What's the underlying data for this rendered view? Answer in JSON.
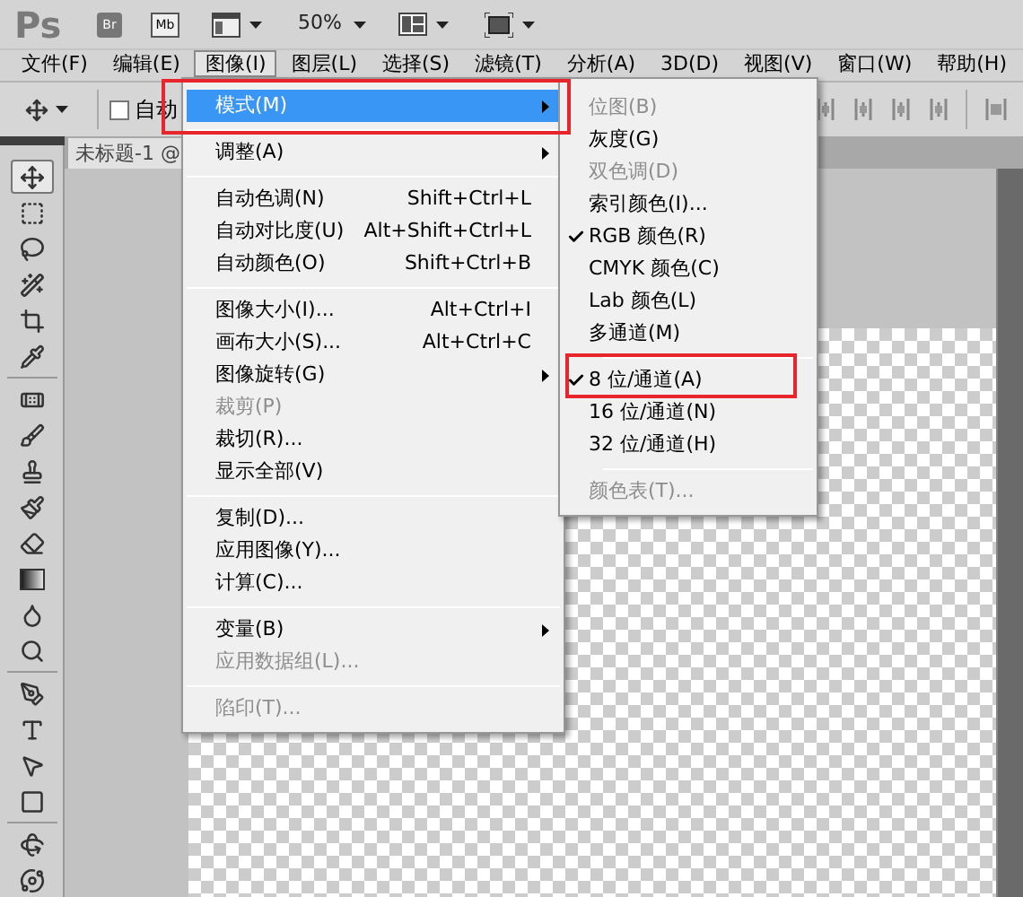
{
  "app_bar": {
    "logo": "Ps",
    "bridge": "Br",
    "mini_bridge": "Mb",
    "zoom": "50%"
  },
  "menu_bar": [
    {
      "label": "文件(F)",
      "selected": false
    },
    {
      "label": "编辑(E)",
      "selected": false
    },
    {
      "label": "图像(I)",
      "selected": true
    },
    {
      "label": "图层(L)",
      "selected": false
    },
    {
      "label": "选择(S)",
      "selected": false
    },
    {
      "label": "滤镜(T)",
      "selected": false
    },
    {
      "label": "分析(A)",
      "selected": false
    },
    {
      "label": "3D(D)",
      "selected": false
    },
    {
      "label": "视图(V)",
      "selected": false
    },
    {
      "label": "窗口(W)",
      "selected": false
    },
    {
      "label": "帮助(H)",
      "selected": false
    }
  ],
  "options_bar": {
    "auto_select": {
      "label": "自动",
      "checked": false
    }
  },
  "tools": [
    {
      "kind": "move",
      "selected": true
    },
    {
      "kind": "marquee",
      "selected": false
    },
    {
      "kind": "lasso",
      "selected": false
    },
    {
      "kind": "wand",
      "selected": false
    },
    {
      "kind": "crop",
      "selected": false
    },
    {
      "kind": "eyedropper",
      "selected": false
    },
    {
      "kind": "separator"
    },
    {
      "kind": "healing",
      "selected": false
    },
    {
      "kind": "brush",
      "selected": false
    },
    {
      "kind": "stamp",
      "selected": false
    },
    {
      "kind": "history",
      "selected": false
    },
    {
      "kind": "eraser",
      "selected": false
    },
    {
      "kind": "gradient",
      "selected": false
    },
    {
      "kind": "blur",
      "selected": false
    },
    {
      "kind": "dodge",
      "selected": false
    },
    {
      "kind": "separator"
    },
    {
      "kind": "pen",
      "selected": false
    },
    {
      "kind": "type",
      "selected": false
    },
    {
      "kind": "select",
      "selected": false
    },
    {
      "kind": "shape",
      "selected": false
    },
    {
      "kind": "separator"
    },
    {
      "kind": "rotate3d",
      "selected": false
    },
    {
      "kind": "orbit",
      "selected": false
    }
  ],
  "document_tab": {
    "title": "未标题-1 @"
  },
  "image_menu": {
    "items": [
      {
        "kind": "item",
        "label": "模式(M)",
        "submenu": true,
        "selected": true,
        "disabled": false
      },
      {
        "kind": "separator"
      },
      {
        "kind": "item",
        "label": "调整(A)",
        "submenu": true,
        "selected": false,
        "disabled": false
      },
      {
        "kind": "separator"
      },
      {
        "kind": "item",
        "label": "自动色调(N)",
        "shortcut": "Shift+Ctrl+L",
        "submenu": false,
        "selected": false,
        "disabled": false
      },
      {
        "kind": "item",
        "label": "自动对比度(U)",
        "shortcut": "Alt+Shift+Ctrl+L",
        "submenu": false,
        "selected": false,
        "disabled": false
      },
      {
        "kind": "item",
        "label": "自动颜色(O)",
        "shortcut": "Shift+Ctrl+B",
        "submenu": false,
        "selected": false,
        "disabled": false
      },
      {
        "kind": "separator"
      },
      {
        "kind": "item",
        "label": "图像大小(I)...",
        "shortcut": "Alt+Ctrl+I",
        "submenu": false,
        "selected": false,
        "disabled": false
      },
      {
        "kind": "item",
        "label": "画布大小(S)...",
        "shortcut": "Alt+Ctrl+C",
        "submenu": false,
        "selected": false,
        "disabled": false
      },
      {
        "kind": "item",
        "label": "图像旋转(G)",
        "submenu": true,
        "selected": false,
        "disabled": false
      },
      {
        "kind": "item",
        "label": "裁剪(P)",
        "submenu": false,
        "selected": false,
        "disabled": true
      },
      {
        "kind": "item",
        "label": "裁切(R)...",
        "submenu": false,
        "selected": false,
        "disabled": false
      },
      {
        "kind": "item",
        "label": "显示全部(V)",
        "submenu": false,
        "selected": false,
        "disabled": false
      },
      {
        "kind": "separator"
      },
      {
        "kind": "item",
        "label": "复制(D)...",
        "submenu": false,
        "selected": false,
        "disabled": false
      },
      {
        "kind": "item",
        "label": "应用图像(Y)...",
        "submenu": false,
        "selected": false,
        "disabled": false
      },
      {
        "kind": "item",
        "label": "计算(C)...",
        "submenu": false,
        "selected": false,
        "disabled": false
      },
      {
        "kind": "separator"
      },
      {
        "kind": "item",
        "label": "变量(B)",
        "submenu": true,
        "selected": false,
        "disabled": false
      },
      {
        "kind": "item",
        "label": "应用数据组(L)...",
        "submenu": false,
        "selected": false,
        "disabled": true
      },
      {
        "kind": "separator"
      },
      {
        "kind": "item",
        "label": "陷印(T)...",
        "submenu": false,
        "selected": false,
        "disabled": true
      }
    ]
  },
  "mode_submenu": {
    "items": [
      {
        "kind": "item",
        "label": "位图(B)",
        "checked": false,
        "disabled": true
      },
      {
        "kind": "item",
        "label": "灰度(G)",
        "checked": false,
        "disabled": false
      },
      {
        "kind": "item",
        "label": "双色调(D)",
        "checked": false,
        "disabled": true
      },
      {
        "kind": "item",
        "label": "索引颜色(I)...",
        "checked": false,
        "disabled": false
      },
      {
        "kind": "item",
        "label": "RGB 颜色(R)",
        "checked": true,
        "disabled": false
      },
      {
        "kind": "item",
        "label": "CMYK 颜色(C)",
        "checked": false,
        "disabled": false
      },
      {
        "kind": "item",
        "label": "Lab 颜色(L)",
        "checked": false,
        "disabled": false
      },
      {
        "kind": "item",
        "label": "多通道(M)",
        "checked": false,
        "disabled": false
      },
      {
        "kind": "separator"
      },
      {
        "kind": "item",
        "label": "8 位/通道(A)",
        "checked": true,
        "disabled": false
      },
      {
        "kind": "item",
        "label": "16 位/通道(N)",
        "checked": false,
        "disabled": false
      },
      {
        "kind": "item",
        "label": "32 位/通道(H)",
        "checked": false,
        "disabled": false
      },
      {
        "kind": "separator"
      },
      {
        "kind": "item",
        "label": "颜色表(T)...",
        "checked": false,
        "disabled": true
      }
    ]
  }
}
